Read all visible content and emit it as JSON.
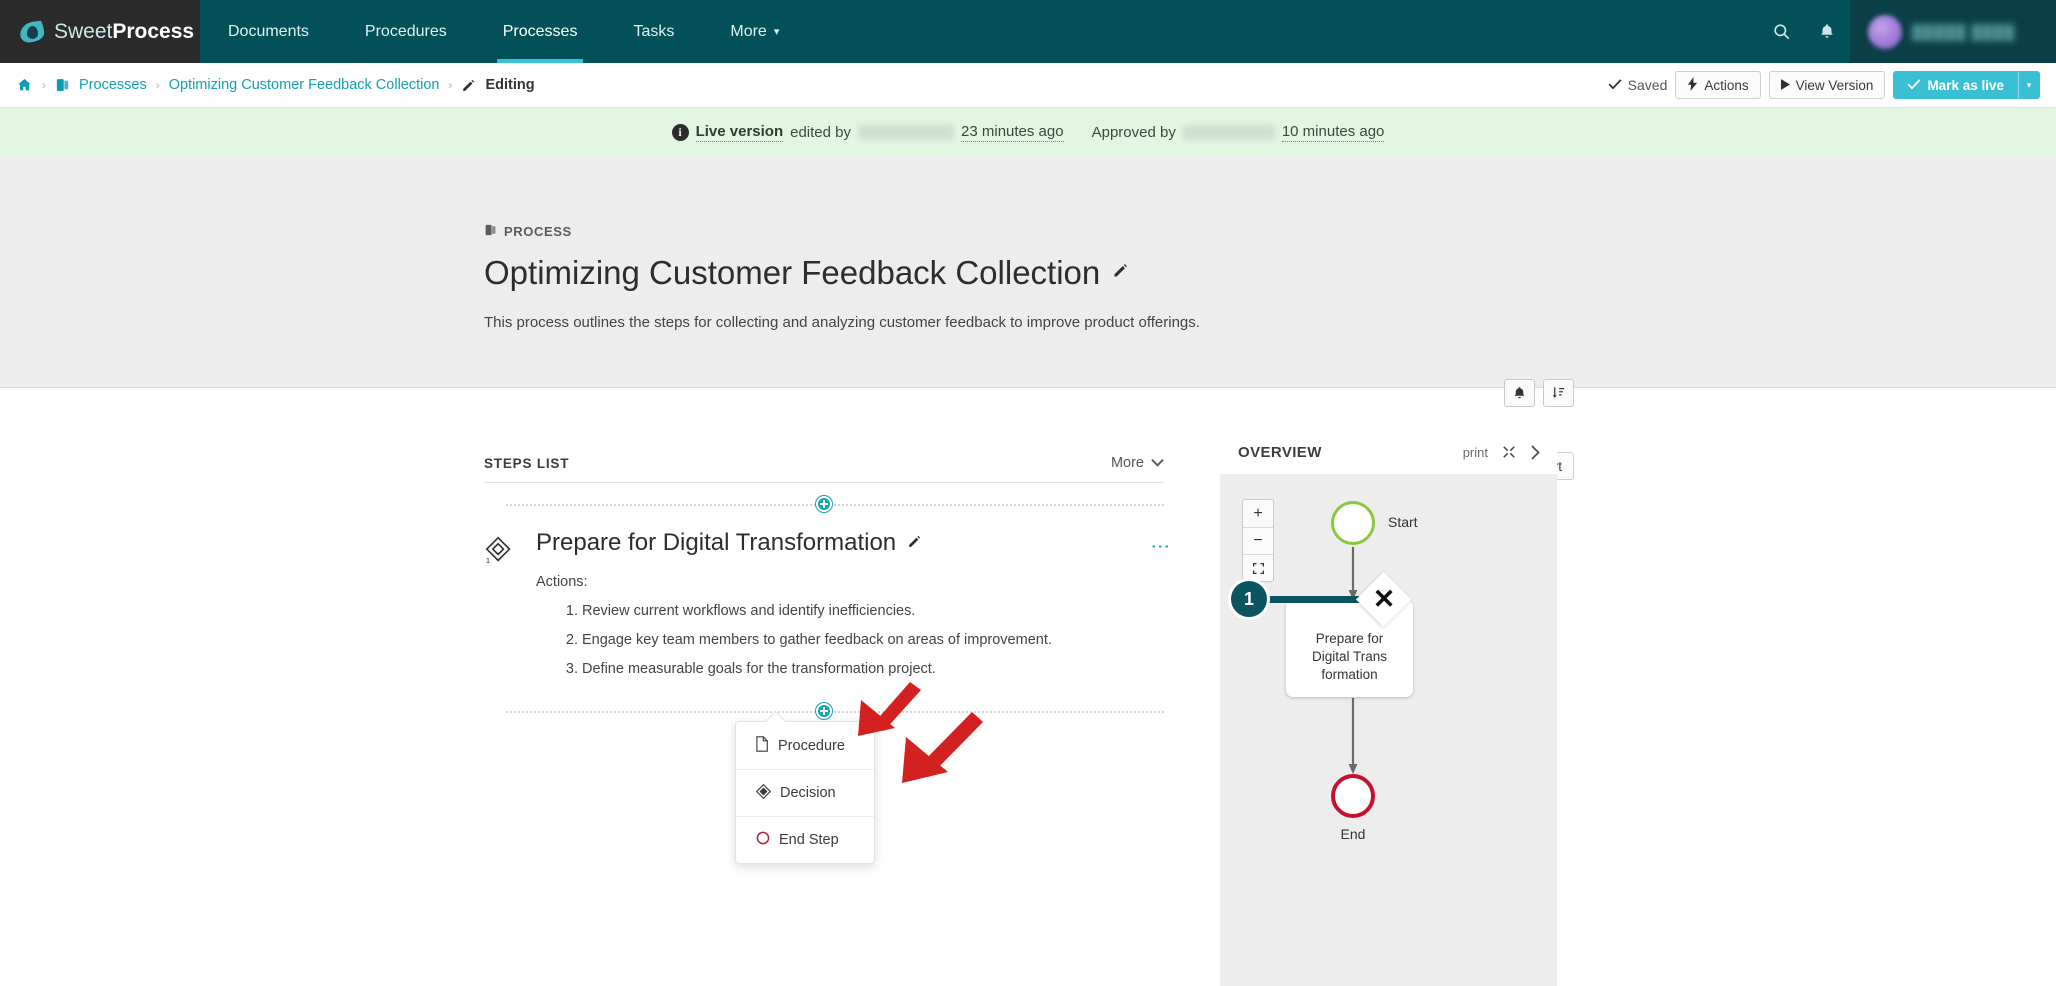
{
  "topnav": {
    "brand": {
      "thin": "Sweet",
      "bold": "Process",
      "logo_icon": "sweetprocess-leaf-logo"
    },
    "items": [
      {
        "label": "Documents",
        "active": false
      },
      {
        "label": "Procedures",
        "active": false
      },
      {
        "label": "Processes",
        "active": true
      },
      {
        "label": "Tasks",
        "active": false
      },
      {
        "label": "More",
        "active": false,
        "caret": "▾"
      }
    ],
    "search_icon": "search-icon",
    "bell_icon": "notification-bell-icon",
    "user_name": "",
    "accent": "#025159",
    "active_underline": "#37c3d6"
  },
  "breadcrumb": {
    "home_icon": "home-icon",
    "processes_icon": "processes-stack-icon",
    "items": [
      {
        "label": "Processes",
        "type": "link"
      },
      {
        "label": "Optimizing Customer Feedback Collection",
        "type": "link"
      },
      {
        "label": "Editing",
        "type": "current",
        "icon": "pencil-icon"
      }
    ],
    "separator": "›",
    "saved_label": "Saved",
    "saved_icon": "check-icon",
    "actions_label": "Actions",
    "actions_icon": "bolt-icon",
    "view_version_label": "View Version",
    "view_version_icon": "play-triangle-icon",
    "mark_as_live_label": "Mark as live",
    "mark_as_live_icon": "check-icon",
    "mark_as_live_caret": "▾",
    "live_color": "#3ac0d4"
  },
  "notice": {
    "info_icon": "info-icon",
    "live_version": "Live version",
    "edited_by": "edited by",
    "edited_time": "23 minutes ago",
    "approved_by": "Approved by",
    "approved_time": "10 minutes ago",
    "background": "#e3f6e2"
  },
  "header": {
    "kicker": "PROCESS",
    "kicker_icon": "process-document-icon",
    "title": "Optimizing Customer Feedback Collection",
    "title_edit_icon": "pencil-icon",
    "description": "This process outlines the steps for collecting and analyzing customer feedback to improve product offerings.",
    "bell_button_icon": "notification-bell-icon",
    "sort_button_icon": "sort-icon",
    "start_label": "Start",
    "start_icon": "play-triangle-icon"
  },
  "steps": {
    "section_label": "STEPS LIST",
    "more_label": "More",
    "more_caret": "▾",
    "add_icon": "plus-circle-icon",
    "items": [
      {
        "number": "1",
        "type_icon": "decision-diamond-icon",
        "title": "Prepare for Digital Transformation",
        "edit_icon": "pencil-icon",
        "kebab_icon": "vertical-dots-icon",
        "body_label": "Actions:",
        "actions": [
          "Review current workflows and identify inefficiencies.",
          "Engage key team members to gather feedback on areas of improvement.",
          "Define measurable goals for the transformation project."
        ]
      }
    ]
  },
  "add_step_menu": {
    "items": [
      {
        "label": "Procedure",
        "icon": "file-page-icon",
        "color": "#3b3b3b"
      },
      {
        "label": "Decision",
        "icon": "decision-diamond-icon",
        "color": "#3b3b3b"
      },
      {
        "label": "End Step",
        "icon": "red-circle-icon",
        "color": "#3b3b3b"
      }
    ]
  },
  "annotations": {
    "arrow_color": "#d32020",
    "arrows": [
      {
        "name": "arrow-to-add-step-button"
      },
      {
        "name": "arrow-to-procedure-option"
      }
    ]
  },
  "overview": {
    "title": "OVERVIEW",
    "print_label": "print",
    "expand_icon": "expand-arrows-icon",
    "collapse_icon": "chevron-right-icon",
    "zoom_in": "+",
    "zoom_out": "−",
    "fit_icon": "fit-screen-icon",
    "flow": {
      "start_label": "Start",
      "start_color": "#8dc63f",
      "node_number": "1",
      "node_label": "Prepare for\nDigital Trans\nformation",
      "node_label_lines": [
        "Prepare for",
        "Digital Trans",
        "formation"
      ],
      "node_accent": "#0b5560",
      "node_marker": "✕",
      "end_label": "End",
      "end_color": "#c6112d"
    }
  }
}
